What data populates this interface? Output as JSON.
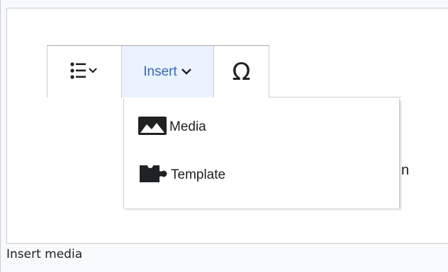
{
  "toolbar": {
    "list_icon": "bullet-list-icon",
    "insert_label": "Insert",
    "special_char_label": "Ω"
  },
  "insert_menu": {
    "items": [
      {
        "label": "Media",
        "icon": "image-icon"
      },
      {
        "label": "Template",
        "icon": "puzzle-icon"
      }
    ]
  },
  "underlying_text_fragment": "n",
  "caption": "Insert media",
  "colors": {
    "accent": "#3366cc",
    "insert_active_bg": "#eaf3ff",
    "text": "#202122",
    "border": "#c8ccd1",
    "page_bg": "#f8f9fa"
  }
}
